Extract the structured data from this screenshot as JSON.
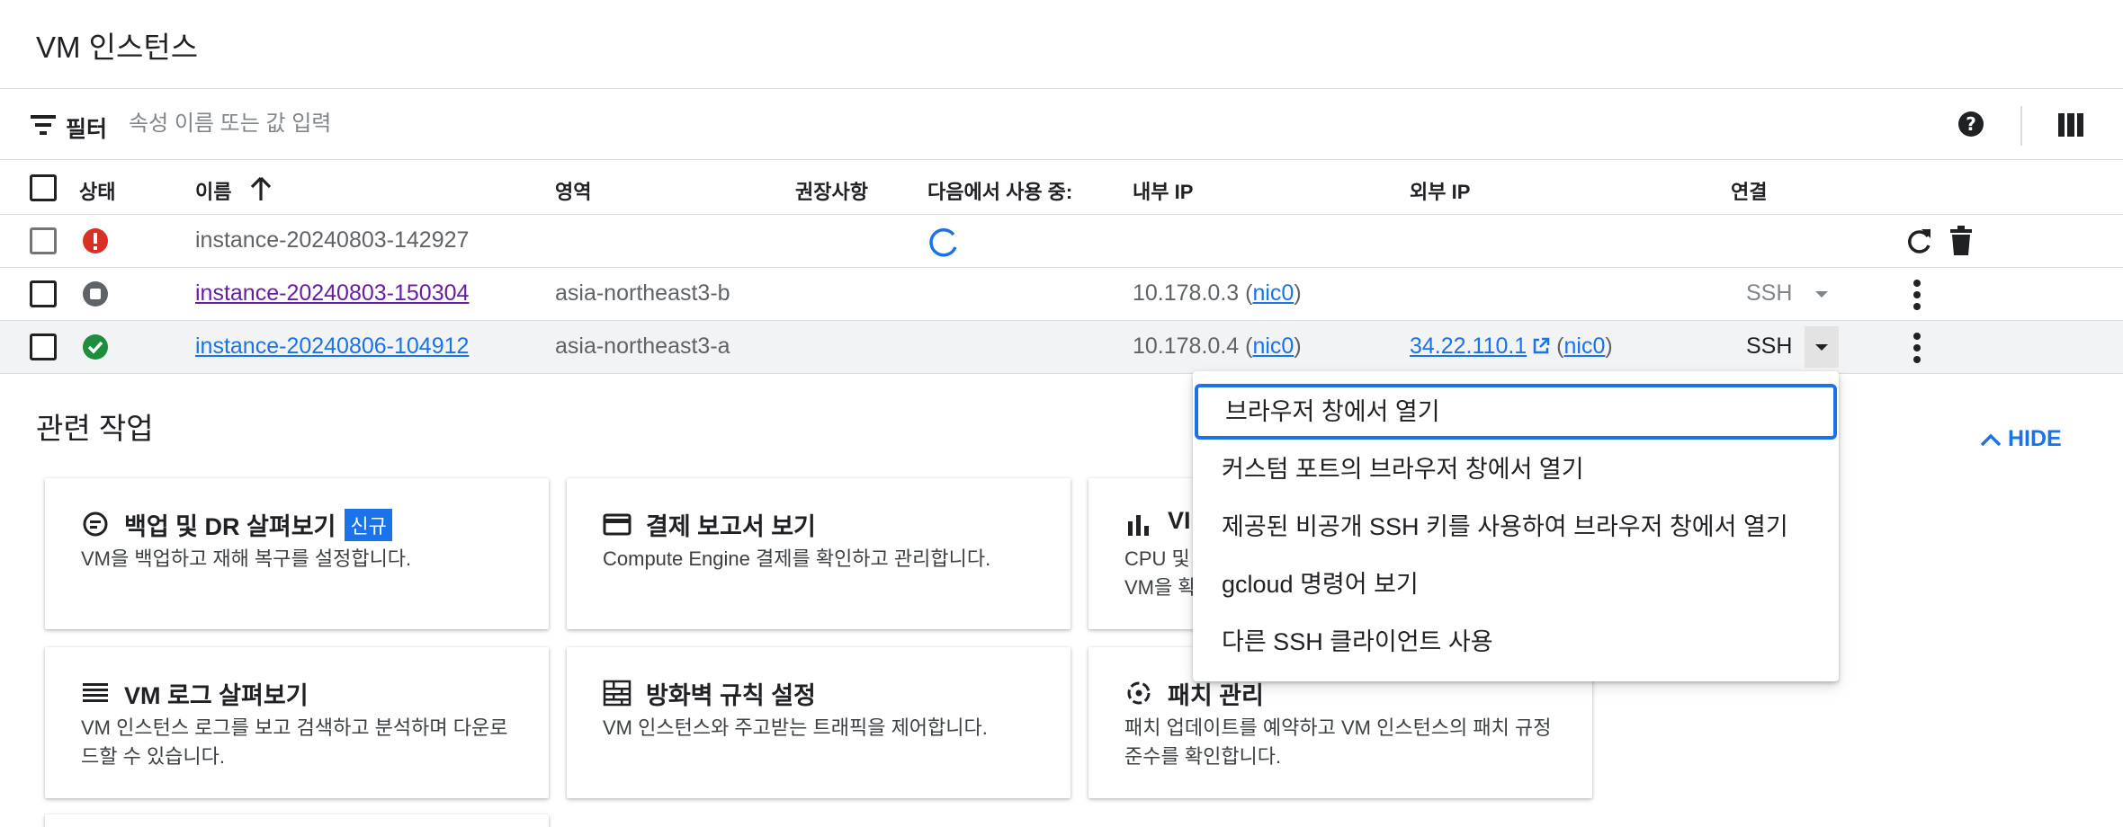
{
  "page": {
    "title": "VM 인스턴스"
  },
  "filter": {
    "label": "필터",
    "placeholder": "속성 이름 또는 값 입력"
  },
  "table": {
    "headers": {
      "status": "상태",
      "name": "이름",
      "zone": "영역",
      "recommendations": "권장사항",
      "in_use_by": "다음에서 사용 중:",
      "internal_ip": "내부 IP",
      "external_ip": "외부 IP",
      "connect": "연결"
    },
    "rows": [
      {
        "status": "error",
        "name": "instance-20240803-142927",
        "zone": "",
        "internal_ip": "",
        "nic": "",
        "external_ip": "",
        "external_nic": "",
        "connect": ""
      },
      {
        "status": "stopped",
        "name": "instance-20240803-150304",
        "zone": "asia-northeast3-b",
        "internal_ip": "10.178.0.3",
        "nic": "nic0",
        "external_ip": "",
        "external_nic": "",
        "connect": "SSH"
      },
      {
        "status": "running",
        "name": "instance-20240806-104912",
        "zone": "asia-northeast3-a",
        "internal_ip": "10.178.0.4",
        "nic": "nic0",
        "external_ip": "34.22.110.1",
        "external_nic": "nic0",
        "connect": "SSH"
      }
    ]
  },
  "related": {
    "title": "관련 작업",
    "hide_label": "HIDE",
    "cards": [
      {
        "title": "백업 및 DR 살펴보기",
        "badge": "신규",
        "desc": "VM을 백업하고 재해 복구를 설정합니다."
      },
      {
        "title": "결제 보고서 보기",
        "desc": "Compute Engine 결제를 확인하고 관리합니다."
      },
      {
        "title": "VI",
        "desc_line1": "CPU 및",
        "desc_line2": "VM을 확"
      },
      {
        "title": "VM 로그 살펴보기",
        "desc": "VM 인스턴스 로그를 보고 검색하고 분석하며 다운로드할 수 있습니다."
      },
      {
        "title": "방화벽 규칙 설정",
        "desc": "VM 인스턴스와 주고받는 트래픽을 제어합니다."
      },
      {
        "title": "패치 관리",
        "desc": "패치 업데이트를 예약하고 VM 인스턴스의 패치 규정 준수를 확인합니다."
      }
    ]
  },
  "ssh_menu": {
    "items": [
      "브라우저 창에서 열기",
      "커스텀 포트의 브라우저 창에서 열기",
      "제공된 비공개 SSH 키를 사용하여 브라우저 창에서 열기",
      "gcloud 명령어 보기",
      "다른 SSH 클라이언트 사용"
    ]
  },
  "colors": {
    "accent": "#1a73e8",
    "error": "#d93025",
    "success": "#1e8e3e",
    "stopped": "#5f6368",
    "visited": "#681da8"
  }
}
